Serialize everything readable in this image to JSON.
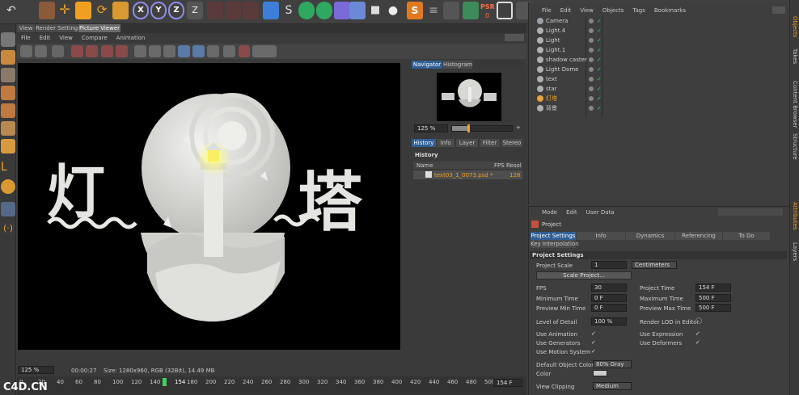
{
  "main_toolbar": {
    "xyz_buttons": [
      "X",
      "Y",
      "Z"
    ],
    "psr_label": "PSR",
    "psr_value": "0"
  },
  "picture_viewer": {
    "tabs": [
      "View",
      "Render Settings",
      "Picture Viewer"
    ],
    "menu": [
      "File",
      "Edit",
      "View",
      "Compare",
      "Animation"
    ],
    "status": {
      "zoom": "125 %",
      "time": "00:00:27",
      "size_info": "Size: 1280x960, RGB (32Bit), 14.49 MB"
    },
    "navigator": {
      "tabs": [
        "Navigator",
        "Histogram"
      ],
      "zoom": "125 %"
    },
    "history": {
      "tabs": [
        "History",
        "Info",
        "Layer",
        "Filter",
        "Stereo"
      ],
      "heading": "History",
      "columns": [
        "Name",
        "FPS",
        "Resol"
      ],
      "rows": [
        {
          "name": "text03_1_0073.psd *",
          "res": "128"
        }
      ]
    },
    "render_text_left": "灯",
    "render_text_right": "塔"
  },
  "timeline": {
    "ticks": [
      "0",
      "20",
      "40",
      "60",
      "80",
      "100",
      "120",
      "140",
      "154",
      "180",
      "200",
      "220",
      "240",
      "260",
      "280",
      "300",
      "320",
      "340",
      "360",
      "380",
      "400",
      "420",
      "440",
      "460",
      "480",
      "50("
    ],
    "current_frame": "154",
    "end_field": "154 F",
    "watermark": "C4D.CN"
  },
  "object_manager": {
    "menu": [
      "File",
      "Edit",
      "View",
      "Objects",
      "Tags",
      "Bookmarks"
    ],
    "objects": [
      {
        "name": "Camera",
        "color": "#9aa0a8"
      },
      {
        "name": "Light.4",
        "color": "#b0b0b0"
      },
      {
        "name": "Light",
        "color": "#b0b0b0"
      },
      {
        "name": "Light.1",
        "color": "#b0b0b0"
      },
      {
        "name": "shadow caster",
        "color": "#b0b0b0"
      },
      {
        "name": "Light Dome",
        "color": "#b0b0b0"
      },
      {
        "name": "text",
        "color": "#b0b0b0"
      },
      {
        "name": "star",
        "color": "#b0b0b0"
      },
      {
        "name": "灯塔",
        "color": "#e8a33c"
      },
      {
        "name": "背景",
        "color": "#b0b0b0"
      }
    ]
  },
  "side_tabs": [
    "Objects",
    "Takes",
    "Content Browser",
    "Structure",
    "Attributes",
    "Layers"
  ],
  "attributes": {
    "menu": [
      "Mode",
      "Edit",
      "User Data"
    ],
    "title": "Project",
    "tabs": [
      "Project Settings",
      "Info",
      "Dynamics",
      "Referencing",
      "To Do"
    ],
    "tab2": "Key Interpolation",
    "section": "Project Settings",
    "project_scale": {
      "label": "Project Scale",
      "value": "1",
      "unit": "Centimeters"
    },
    "scale_button": "Scale Project...",
    "fps": {
      "label": "FPS",
      "value": "30"
    },
    "project_time": {
      "label": "Project Time",
      "value": "154 F"
    },
    "min_time": {
      "label": "Minimum Time",
      "value": "0 F"
    },
    "max_time": {
      "label": "Maximum Time",
      "value": "500 F"
    },
    "preview_min": {
      "label": "Preview Min Time",
      "value": "0 F"
    },
    "preview_max": {
      "label": "Preview Max Time",
      "value": "500 F"
    },
    "lod": {
      "label": "Level of Detail",
      "value": "100 %"
    },
    "render_lod": "Render LOD in Editor",
    "use_animation": "Use Animation",
    "use_expression": "Use Expression",
    "use_generators": "Use Generators",
    "use_deformers": "Use Deformers",
    "use_motion": "Use Motion System",
    "default_color": {
      "label": "Default Object Color",
      "value": "80% Gray"
    },
    "color_label": "Color",
    "view_clipping": {
      "label": "View Clipping",
      "value": "Medium"
    }
  },
  "colors": {
    "accent_blue": "#2f5f95",
    "highlight_orange": "#f0a020",
    "timeline_marker": "#3fd060"
  }
}
